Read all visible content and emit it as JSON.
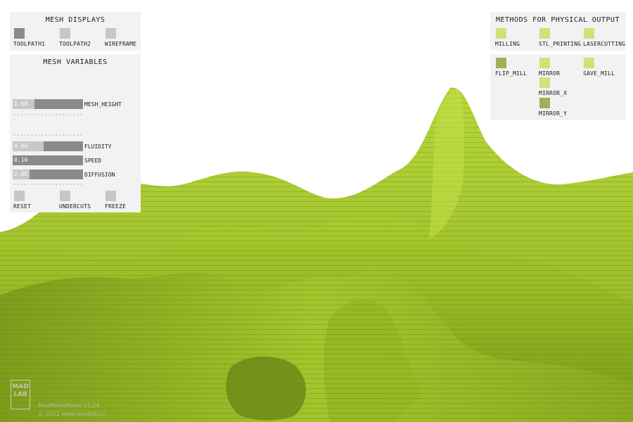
{
  "colors": {
    "panel_bg": "#f2f2f2",
    "toggle_dark": "#8a8a8a",
    "toggle_light": "#c6c6c6",
    "output_light": "#d2e07a",
    "output_dark": "#a4ad5a",
    "mesh": "#a8cc2c"
  },
  "mesh_displays": {
    "title": "MESH DISPLAYS",
    "toggles": [
      {
        "label": "TOOLPATH1",
        "active": true
      },
      {
        "label": "TOOLPATH2",
        "active": false
      },
      {
        "label": "WIREFRAME",
        "active": false
      }
    ]
  },
  "mesh_variables": {
    "title": "MESH VARIABLES",
    "sliders": [
      {
        "label": "MESH_HEIGHT",
        "value": "1.60",
        "level": 0.31
      },
      {
        "label": "FLUIDITY",
        "value": "4.96",
        "level": 0.44
      },
      {
        "label": "SPEED",
        "value": "0.10",
        "level": 0.0
      },
      {
        "label": "DIFFUSION",
        "value": "2.0E",
        "level": 0.24
      }
    ],
    "buttons": [
      {
        "label": "RESET"
      },
      {
        "label": "UNDERCUTS"
      },
      {
        "label": "FREEZE"
      }
    ]
  },
  "output": {
    "title": "METHODS FOR PHYSICAL OUTPUT",
    "items": [
      {
        "label": "MILLING",
        "active": false
      },
      {
        "label": "STL_PRINTING",
        "active": false
      },
      {
        "label": "LASERCUTTING",
        "active": false
      },
      {
        "label": "FLIP_MILL",
        "active": true
      },
      {
        "label": "MIRROR",
        "active": false
      },
      {
        "label": "SAVE_MILL",
        "active": false
      },
      {
        "label": "MIRROR_X",
        "active": false
      },
      {
        "label": "MIRROR_Y",
        "active": true
      }
    ]
  },
  "footer": {
    "logo_line1": "MAD",
    "logo_line2": "LAB",
    "app_name": "MadMeshMaker v1.24",
    "copyright": "© 2011 www.madlab.cc"
  }
}
